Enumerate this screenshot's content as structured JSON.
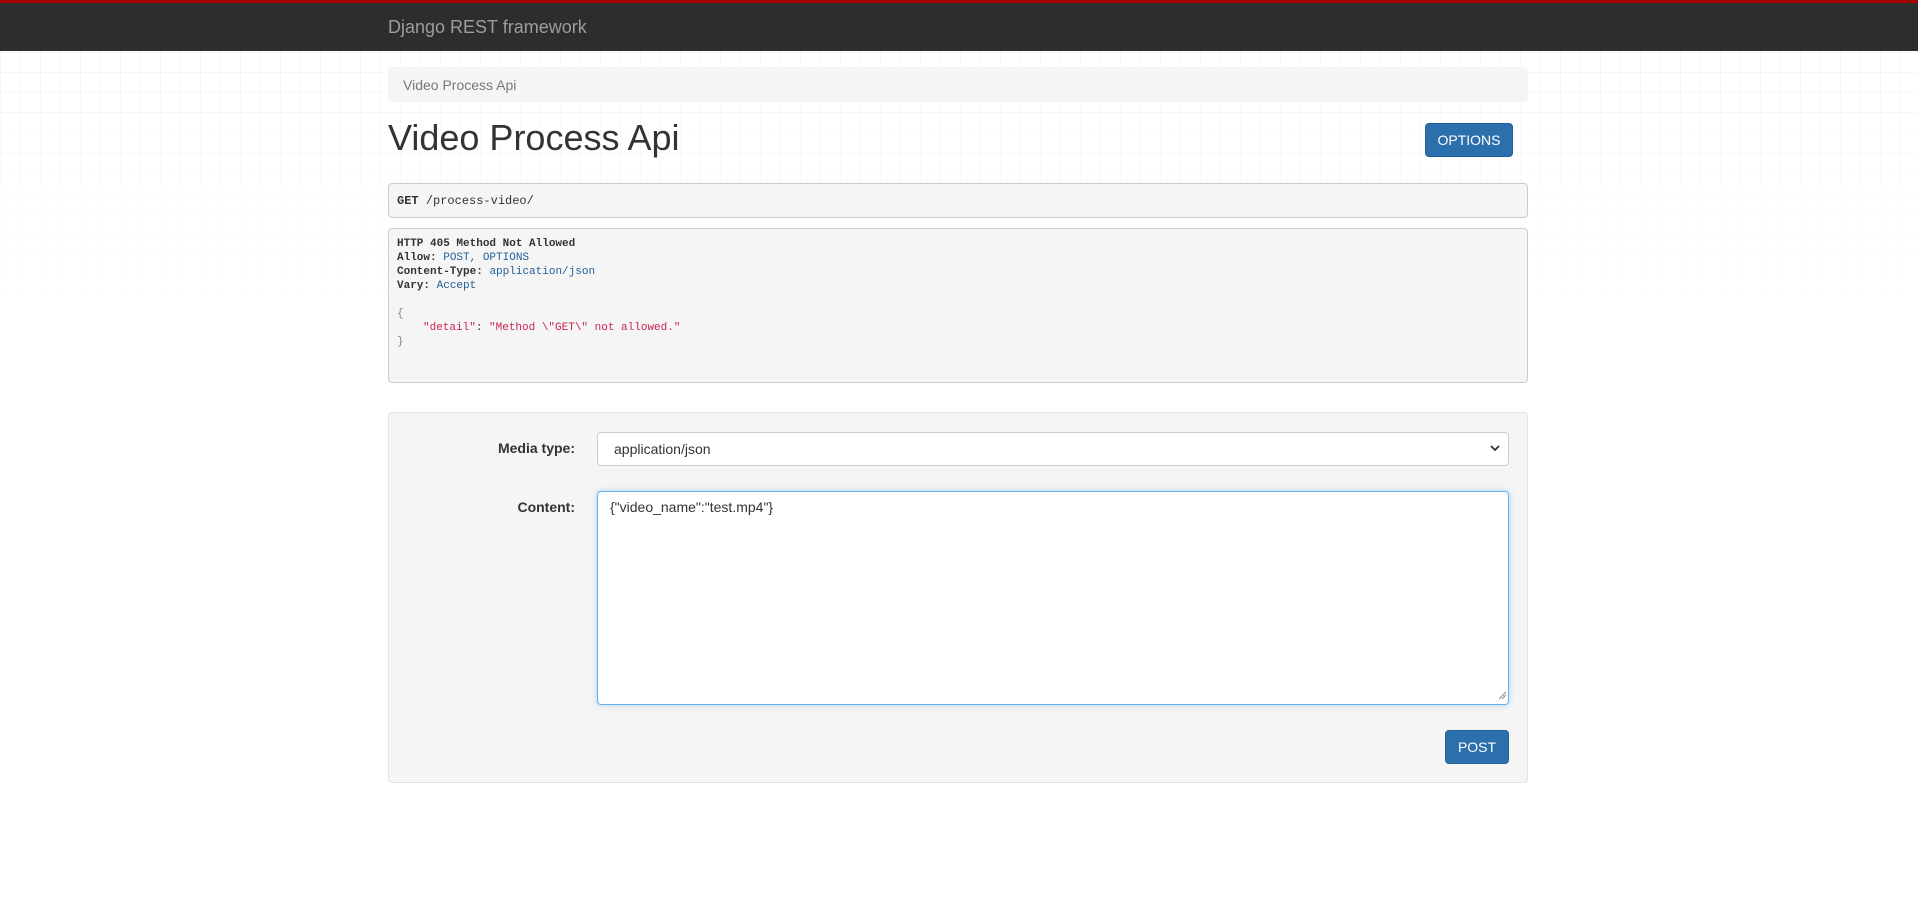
{
  "navbar": {
    "brand": "Django REST framework"
  },
  "breadcrumb": {
    "items": [
      "Video Process Api"
    ]
  },
  "page": {
    "title": "Video Process Api",
    "options_label": "OPTIONS"
  },
  "request": {
    "method": "GET",
    "path": "/process-video/"
  },
  "response": {
    "status_line": "HTTP 405 Method Not Allowed",
    "headers": [
      {
        "name": "Allow:",
        "value": "POST, OPTIONS"
      },
      {
        "name": "Content-Type:",
        "value": "application/json"
      },
      {
        "name": "Vary:",
        "value": "Accept"
      }
    ],
    "body": {
      "open_brace": "{",
      "key": "\"detail\"",
      "colon": ": ",
      "value": "\"Method \\\"GET\\\" not allowed.\"",
      "close_brace": "}"
    }
  },
  "form": {
    "media_type_label": "Media type:",
    "media_type_value": "application/json",
    "content_label": "Content:",
    "content_value": "{\"video_name\":\"test.mp4\"}",
    "post_label": "POST"
  },
  "colors": {
    "navbar_bg": "#2d2d2d",
    "navbar_accent": "#a30000",
    "button_primary": "#2c6fad",
    "header_value": "#1f5f99",
    "json_string": "#c7254e"
  },
  "icons": {
    "select_caret": "chevron-down-icon",
    "resize": "resize-handle-icon"
  }
}
